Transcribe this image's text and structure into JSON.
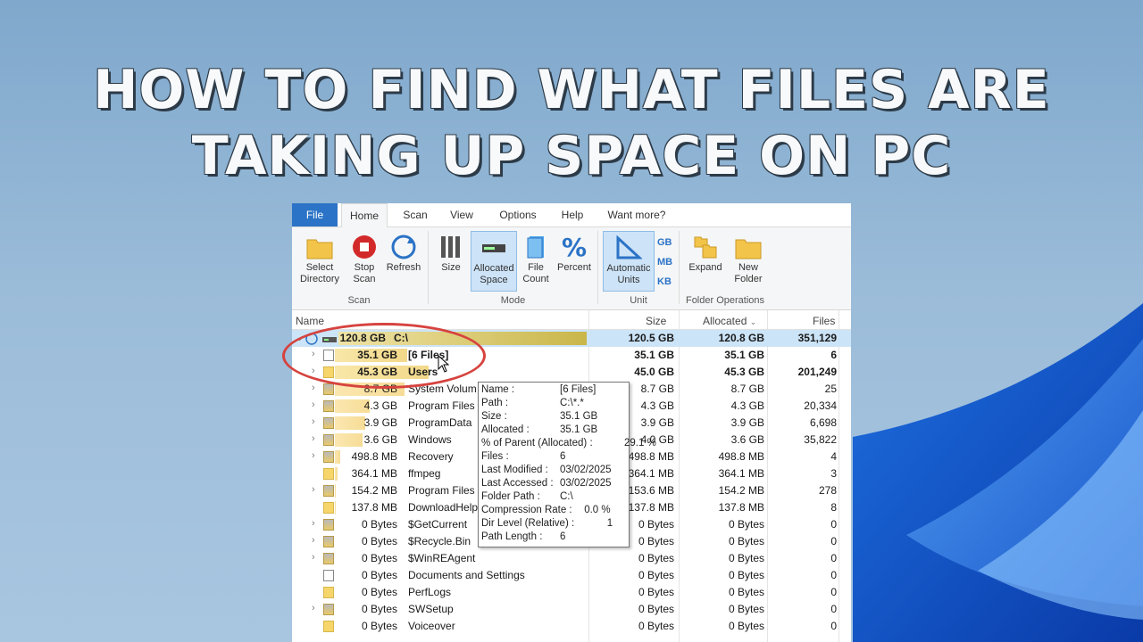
{
  "headline": {
    "line1": "HOW TO FIND WHAT FILES ARE",
    "line2": "TAKING UP SPACE ON PC"
  },
  "menu_tabs": [
    "File",
    "Home",
    "Scan",
    "View",
    "Options",
    "Help",
    "Want more?"
  ],
  "ribbon": {
    "select_directory": "Select\nDirectory",
    "stop_scan": "Stop\nScan",
    "refresh": "Refresh",
    "size": "Size",
    "allocated_space": "Allocated\nSpace",
    "file_count": "File\nCount",
    "percent": "Percent",
    "automatic_units": "Automatic\nUnits",
    "unit_gb": "GB",
    "unit_mb": "MB",
    "unit_kb": "KB",
    "expand": "Expand",
    "new_folder": "New\nFolder",
    "groups": {
      "scan": "Scan",
      "mode": "Mode",
      "unit": "Unit",
      "folder_ops": "Folder Operations"
    }
  },
  "columns": {
    "name": "Name",
    "size": "Size",
    "allocated": "Allocated",
    "files": "Files"
  },
  "rows": [
    {
      "size": "120.8 GB",
      "name": "C:\\",
      "c1": "120.5 GB",
      "c2": "120.8 GB",
      "c3": "351,129",
      "pct": 1.0
    },
    {
      "size": "35.1 GB",
      "name": "[6 Files]",
      "c1": "35.1 GB",
      "c2": "35.1 GB",
      "c3": "6",
      "pct": 0.291
    },
    {
      "size": "45.3 GB",
      "name": "Users",
      "c1": "45.0 GB",
      "c2": "45.3 GB",
      "c3": "201,249",
      "pct": 0.375
    },
    {
      "size": "8.7 GB",
      "name": "System Volum",
      "c1": "8.7 GB",
      "c2": "8.7 GB",
      "c3": "25",
      "pct": 0.28
    },
    {
      "size": "4.3 GB",
      "name": "Program Files",
      "c1": "4.3 GB",
      "c2": "4.3 GB",
      "c3": "20,334",
      "pct": 0.14
    },
    {
      "size": "3.9 GB",
      "name": "ProgramData",
      "c1": "3.9 GB",
      "c2": "3.9 GB",
      "c3": "6,698",
      "pct": 0.12
    },
    {
      "size": "3.6 GB",
      "name": "Windows",
      "c1": "4.0 GB",
      "c2": "3.6 GB",
      "c3": "35,822",
      "pct": 0.11
    },
    {
      "size": "498.8 MB",
      "name": "Recovery",
      "c1": "498.8 MB",
      "c2": "498.8 MB",
      "c3": "4",
      "pct": 0.02
    },
    {
      "size": "364.1 MB",
      "name": "ffmpeg",
      "c1": "364.1 MB",
      "c2": "364.1 MB",
      "c3": "3",
      "pct": 0.01
    },
    {
      "size": "154.2 MB",
      "name": "Program Files",
      "c1": "153.6 MB",
      "c2": "154.2 MB",
      "c3": "278",
      "pct": 0.005
    },
    {
      "size": "137.8 MB",
      "name": "DownloadHelp",
      "c1": "137.8 MB",
      "c2": "137.8 MB",
      "c3": "8",
      "pct": 0.004
    },
    {
      "size": "0 Bytes",
      "name": "$GetCurrent",
      "c1": "0 Bytes",
      "c2": "0 Bytes",
      "c3": "0",
      "pct": 0
    },
    {
      "size": "0 Bytes",
      "name": "$Recycle.Bin",
      "c1": "0 Bytes",
      "c2": "0 Bytes",
      "c3": "0",
      "pct": 0
    },
    {
      "size": "0 Bytes",
      "name": "$WinREAgent",
      "c1": "0 Bytes",
      "c2": "0 Bytes",
      "c3": "0",
      "pct": 0
    },
    {
      "size": "0 Bytes",
      "name": "Documents and Settings",
      "c1": "0 Bytes",
      "c2": "0 Bytes",
      "c3": "0",
      "pct": 0
    },
    {
      "size": "0 Bytes",
      "name": "PerfLogs",
      "c1": "0 Bytes",
      "c2": "0 Bytes",
      "c3": "0",
      "pct": 0
    },
    {
      "size": "0 Bytes",
      "name": "SWSetup",
      "c1": "0 Bytes",
      "c2": "0 Bytes",
      "c3": "0",
      "pct": 0
    },
    {
      "size": "0 Bytes",
      "name": "Voiceover",
      "c1": "0 Bytes",
      "c2": "0 Bytes",
      "c3": "0",
      "pct": 0
    }
  ],
  "tooltip": [
    {
      "k": "Name :",
      "v": "[6 Files]"
    },
    {
      "k": "Path :",
      "v": "C:\\*.*"
    },
    {
      "k": "Size :",
      "v": "35.1 GB"
    },
    {
      "k": "Allocated :",
      "v": "35.1 GB"
    },
    {
      "k": "% of Parent (Allocated) :",
      "v": "29.1 %"
    },
    {
      "k": "Files :",
      "v": "6"
    },
    {
      "k": "Last Modified :",
      "v": "03/02/2025"
    },
    {
      "k": "Last Accessed :",
      "v": "03/02/2025"
    },
    {
      "k": "Folder Path :",
      "v": "C:\\"
    },
    {
      "k": "Compression Rate :",
      "v": "0.0 %"
    },
    {
      "k": "Dir Level (Relative) :",
      "v": "1"
    },
    {
      "k": "Path Length :",
      "v": "6"
    }
  ],
  "colors": {
    "accent": "#2b73c6",
    "selection": "#cce4f7",
    "bar": "#d8c75a",
    "highlight_circle": "#d6433f"
  }
}
